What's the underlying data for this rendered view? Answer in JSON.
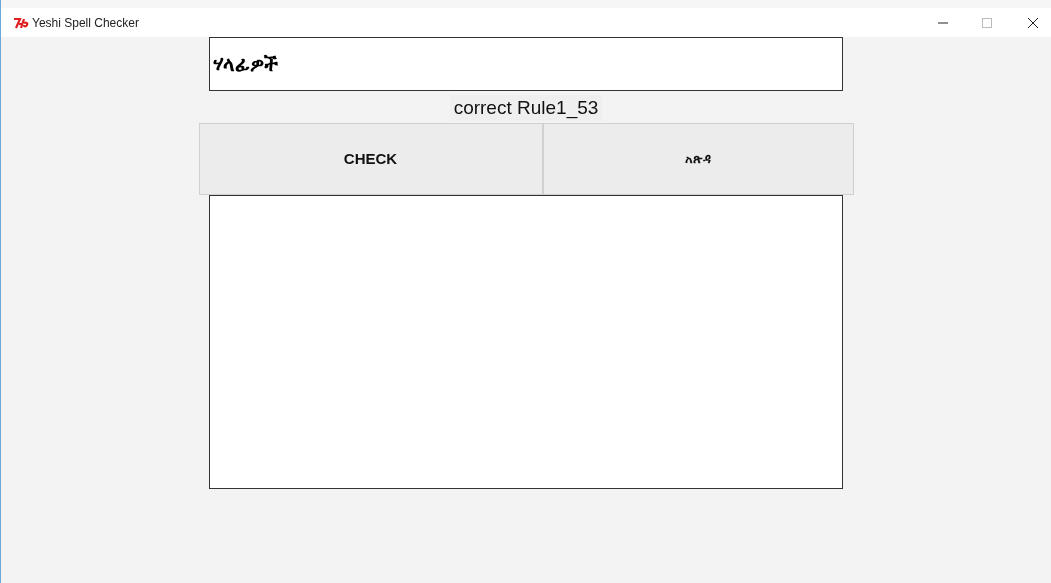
{
  "window": {
    "title": "Yeshi Spell Checker"
  },
  "word_field": {
    "value": "ሃላፊዎች"
  },
  "status": "correct Rule1_53",
  "buttons": [
    "CHECK",
    "አጽዳ"
  ]
}
